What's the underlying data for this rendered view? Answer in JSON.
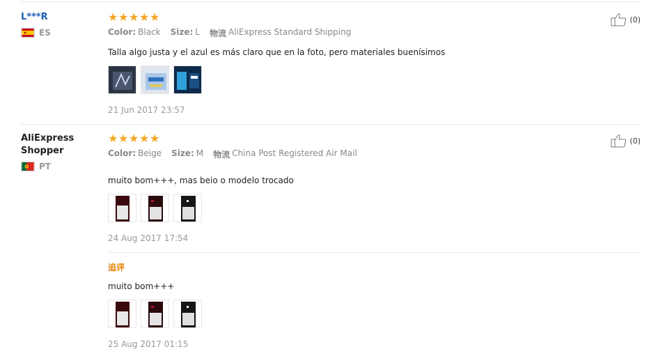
{
  "reviews": [
    {
      "user_name": "L***R",
      "country": "ES",
      "stars": 5,
      "color_label": "Color:",
      "color_value": "Black",
      "size_label": "Size:",
      "size_value": "L",
      "shipping_label": "物流",
      "shipping_value": "AliExpress Standard Shipping",
      "text": "Talla algo justa y el azul es más claro que en la foto, pero materiales buenísimos",
      "date": "21 Jun 2017 23:57",
      "helpful_count": "(0)"
    },
    {
      "user_name": "AliExpress Shopper",
      "country": "PT",
      "stars": 5,
      "color_label": "Color:",
      "color_value": "Beige",
      "size_label": "Size:",
      "size_value": "M",
      "shipping_label": "物流",
      "shipping_value": "China Post Registered Air Mail",
      "text": "muito bom+++, mas beio o modelo trocado",
      "date": "24 Aug 2017 17:54",
      "helpful_count": "(0)",
      "followup": {
        "title": "追评",
        "text": "muito bom+++",
        "date": "25 Aug 2017 01:15"
      }
    }
  ],
  "star_glyph": "★",
  "colors": {
    "star": "#f5a623",
    "username_link": "#1a5eb4",
    "followup_title": "#e68000"
  }
}
